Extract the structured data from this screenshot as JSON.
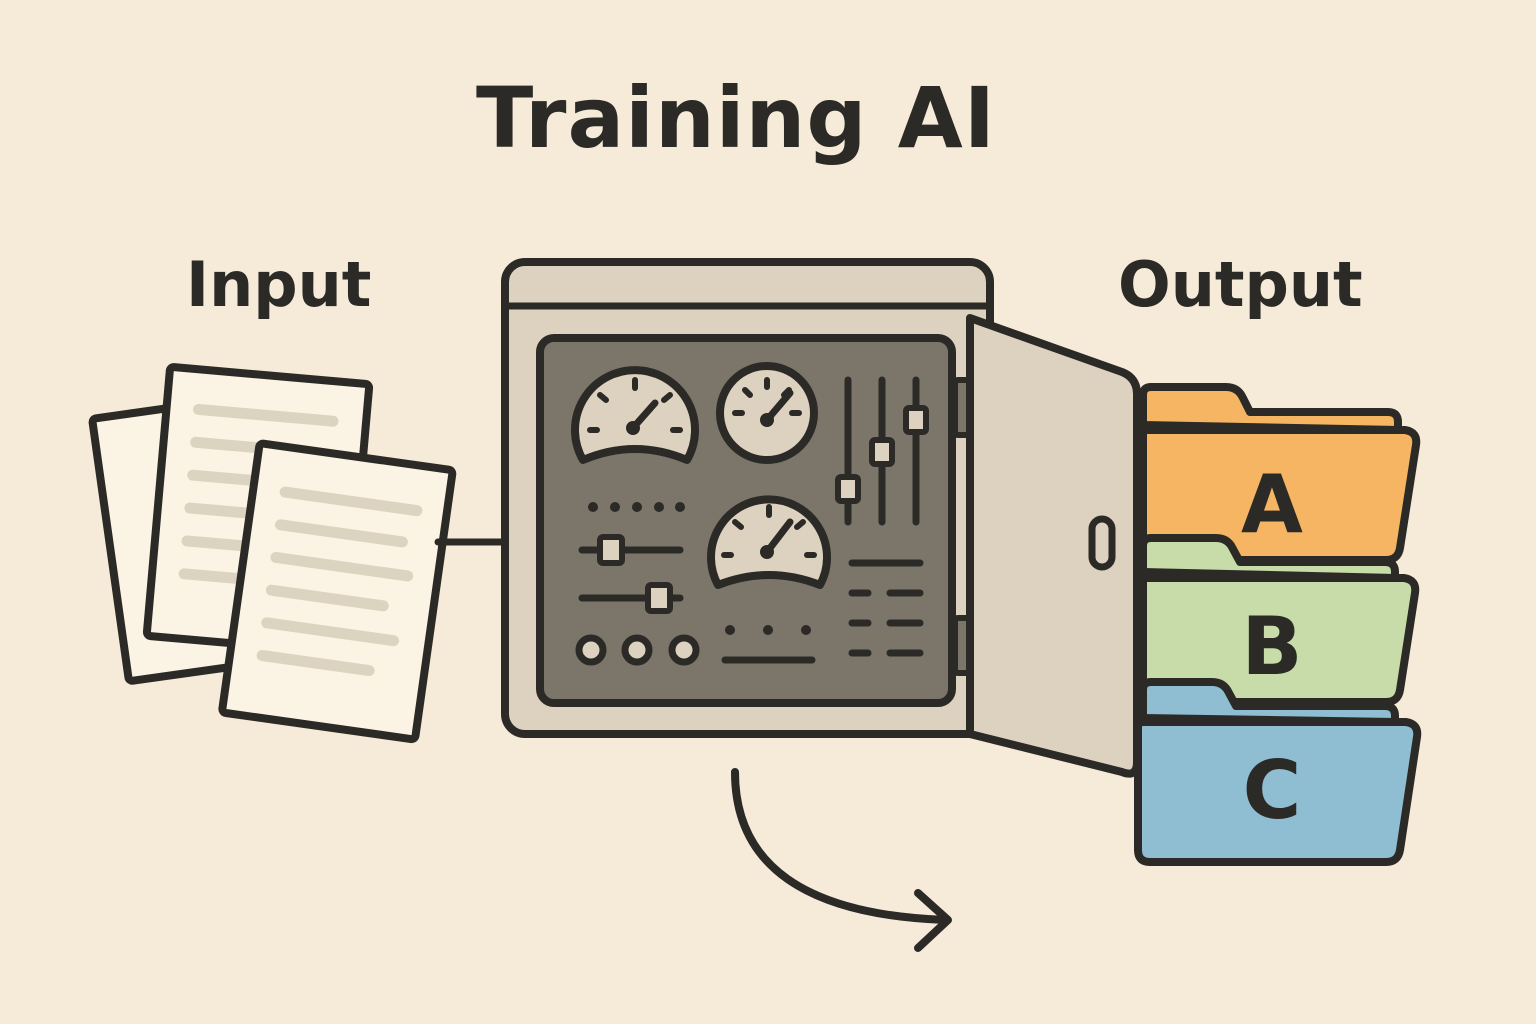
{
  "title": "Training AI",
  "input": {
    "label": "Input"
  },
  "output": {
    "label": "Output",
    "folders": [
      {
        "label": "A",
        "color": "#f5b563"
      },
      {
        "label": "B",
        "color": "#c7dca8"
      },
      {
        "label": "C",
        "color": "#8fbdd1"
      }
    ]
  },
  "colors": {
    "background": "#f6ead8",
    "ink": "#2b2a26",
    "cabinet": "#ddd1bf",
    "panel": "#7b756a",
    "paper": "#fbf3e3",
    "paper_lines": "#dcd4c0"
  }
}
